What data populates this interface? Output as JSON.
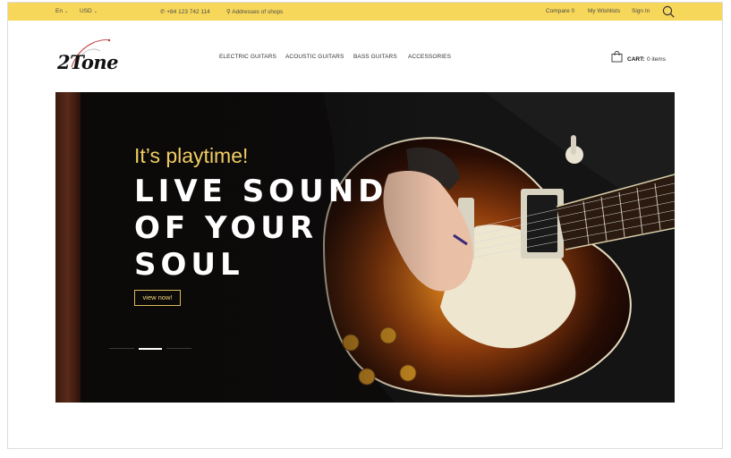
{
  "topbar": {
    "language": "En",
    "currency": "USD",
    "phone": "+84 123 742 114",
    "address": "Addresses of shops",
    "compare": "Compare 0",
    "wishlist": "My Wishlists",
    "signin": "Sign In",
    "background_color": "#f7d75a"
  },
  "logo": {
    "text": "2Tone"
  },
  "nav": {
    "items": [
      "ELECTRIC GUITARS",
      "ACOUSTIC GUITARS",
      "BASS GUITARS",
      "ACCESSORIES"
    ]
  },
  "cart": {
    "label": "CART:",
    "count": "0 items"
  },
  "hero": {
    "kicker": "It’s playtime!",
    "title_lines": [
      "LIVE SOUND",
      "OF YOUR",
      "SOUL"
    ],
    "button": "view now!",
    "accent_color": "#f0cd63",
    "slide_count": 3,
    "active_slide": 2
  },
  "icons": {
    "search": "search-icon",
    "cart": "shopping-bag-icon",
    "phone": "phone-icon",
    "location": "location-pin-icon"
  }
}
